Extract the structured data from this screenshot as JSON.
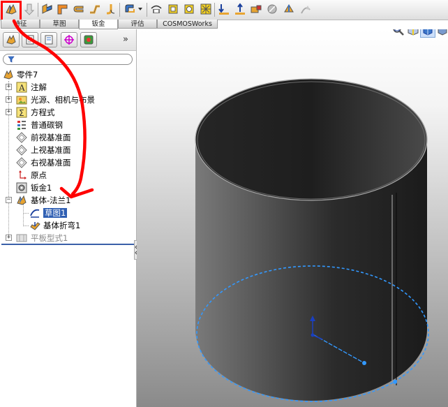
{
  "toolbar": {
    "icons": [
      "base-flange-icon",
      "shell-icon",
      "edge-flange-icon",
      "miter-flange-icon",
      "hem-icon",
      "jog-icon",
      "sketched-bend-icon",
      "closed-corner-icon",
      "corner-relief-dropdown-icon",
      "lofted-bend-icon",
      "forming-tool-icon",
      "extruded-cut-icon",
      "vent-icon",
      "unfold-icon",
      "fold-icon",
      "flatten-icon",
      "no-bends-icon",
      "rip-icon",
      "insert-bends-icon"
    ]
  },
  "tabs": [
    {
      "label": "特征",
      "active": false
    },
    {
      "label": "草图",
      "active": false
    },
    {
      "label": "钣金",
      "active": true
    },
    {
      "label": "评估",
      "active": false
    },
    {
      "label": "COSMOSWorks",
      "active": false
    }
  ],
  "panel": {
    "expand_arrows": "»",
    "tree": [
      {
        "label": "零件7",
        "icon": "part-icon"
      },
      {
        "label": "注解",
        "icon": "annotation-icon"
      },
      {
        "label": "光源、相机与布景",
        "icon": "lights-cameras-scene-icon"
      },
      {
        "label": "方程式",
        "icon": "equations-icon"
      },
      {
        "label": "普通碳钢",
        "icon": "material-icon"
      },
      {
        "label": "前视基准面",
        "icon": "plane-icon"
      },
      {
        "label": "上视基准面",
        "icon": "plane-icon"
      },
      {
        "label": "右视基准面",
        "icon": "plane-icon"
      },
      {
        "label": "原点",
        "icon": "origin-icon"
      },
      {
        "label": "钣金1",
        "icon": "sheet-metal-icon"
      },
      {
        "label": "基体-法兰1",
        "icon": "base-flange-icon"
      },
      {
        "label": "草图1",
        "icon": "sketch-icon",
        "selected": true
      },
      {
        "label": "基体折弯1",
        "icon": "base-bend-icon"
      },
      {
        "label": "平板型式1",
        "icon": "flat-pattern-icon",
        "suppressed": true
      }
    ]
  },
  "colors": {
    "annotation_red": "#ff0000",
    "selection_blue": "#3399ff",
    "tree_selected_bg": "#2f5fb3"
  }
}
